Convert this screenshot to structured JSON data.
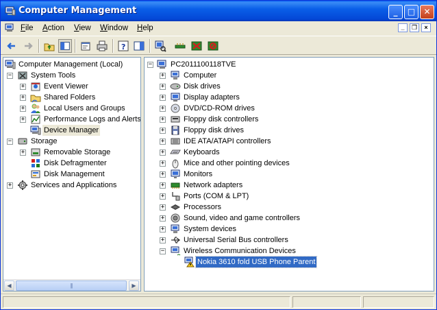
{
  "window": {
    "title": "Computer Management",
    "icon": "computer-management-icon"
  },
  "title_buttons": {
    "minimize": "_",
    "maximize": "□",
    "close": "✕"
  },
  "menu": {
    "items": [
      {
        "label_first": "F",
        "label_rest": "ile"
      },
      {
        "label_first": "A",
        "label_rest": "ction"
      },
      {
        "label_first": "V",
        "label_rest": "iew"
      },
      {
        "label_first": "W",
        "label_rest": "indow"
      },
      {
        "label_first": "H",
        "label_rest": "elp"
      }
    ],
    "mdi": {
      "minimize": "_",
      "restore": "❐",
      "close": "×"
    }
  },
  "toolbar": {
    "icons": [
      "back-arrow-icon",
      "forward-arrow-icon",
      "up-folder-icon",
      "show-hide-tree-icon",
      "properties-icon",
      "print-icon",
      "help-icon",
      "action-pane-icon",
      "scan-hardware-icon",
      "update-driver-icon",
      "uninstall-icon",
      "disable-icon"
    ]
  },
  "tree": {
    "root": "Computer Management (Local)",
    "items": [
      {
        "label": "System Tools",
        "expander": "−"
      },
      {
        "label": "Event Viewer",
        "expander": "+"
      },
      {
        "label": "Shared Folders",
        "expander": "+"
      },
      {
        "label": "Local Users and Groups",
        "expander": "+"
      },
      {
        "label": "Performance Logs and Alerts",
        "expander": "+"
      },
      {
        "label": "Device Manager",
        "expander": ""
      },
      {
        "label": "Storage",
        "expander": "−"
      },
      {
        "label": "Removable Storage",
        "expander": "+"
      },
      {
        "label": "Disk Defragmenter",
        "expander": ""
      },
      {
        "label": "Disk Management",
        "expander": ""
      },
      {
        "label": "Services and Applications",
        "expander": "+"
      }
    ]
  },
  "devices": {
    "root": "PC2011100118TVE",
    "root_expander": "−",
    "items": [
      {
        "label": "Computer",
        "expander": "+"
      },
      {
        "label": "Disk drives",
        "expander": "+"
      },
      {
        "label": "Display adapters",
        "expander": "+"
      },
      {
        "label": "DVD/CD-ROM drives",
        "expander": "+"
      },
      {
        "label": "Floppy disk controllers",
        "expander": "+"
      },
      {
        "label": "Floppy disk drives",
        "expander": "+"
      },
      {
        "label": "IDE ATA/ATAPI controllers",
        "expander": "+"
      },
      {
        "label": "Keyboards",
        "expander": "+"
      },
      {
        "label": "Mice and other pointing devices",
        "expander": "+"
      },
      {
        "label": "Monitors",
        "expander": "+"
      },
      {
        "label": "Network adapters",
        "expander": "+"
      },
      {
        "label": "Ports (COM & LPT)",
        "expander": "+"
      },
      {
        "label": "Processors",
        "expander": "+"
      },
      {
        "label": "Sound, video and game controllers",
        "expander": "+"
      },
      {
        "label": "System devices",
        "expander": "+"
      },
      {
        "label": "Universal Serial Bus controllers",
        "expander": "+"
      },
      {
        "label": "Wireless Communication Devices",
        "expander": "−"
      },
      {
        "label": "Nokia 3610 fold USB Phone Parent",
        "expander": ""
      }
    ]
  },
  "scrollbar": {
    "left": "◀",
    "right": "▶",
    "grip": "|||"
  }
}
